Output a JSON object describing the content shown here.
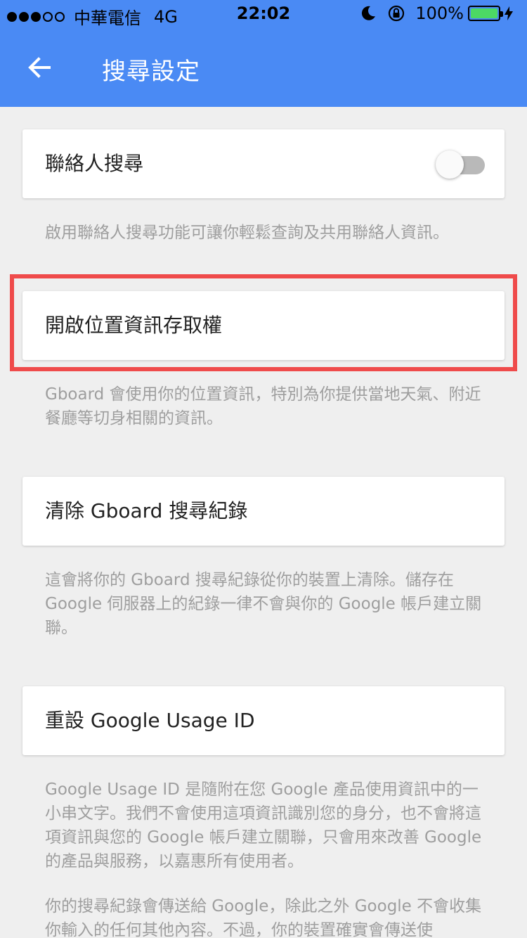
{
  "status_bar": {
    "carrier": "中華電信",
    "network": "4G",
    "time": "22:02",
    "battery": "100%"
  },
  "app_bar": {
    "title": "搜尋設定"
  },
  "settings": [
    {
      "label": "聯絡人搜尋",
      "toggle": false,
      "description": "啟用聯絡人搜尋功能可讓你輕鬆查詢及共用聯絡人資訊。"
    },
    {
      "label": "開啟位置資訊存取權",
      "description": "Gboard 會使用你的位置資訊，特別為你提供當地天氣、附近餐廳等切身相關的資訊。"
    },
    {
      "label": "清除 Gboard 搜尋紀錄",
      "description": "這會將你的 Gboard 搜尋紀錄從你的裝置上清除。儲存在 Google 伺服器上的紀錄一律不會與你的 Google 帳戶建立關聯。"
    },
    {
      "label": "重設 Google Usage ID",
      "description": "Google Usage ID 是隨附在您 Google 產品使用資訊中的一小串文字。我們不會使用這項資訊識別您的身分，也不會將這項資訊與您的 Google 帳戶建立關聯，只會用來改善 Google 的產品與服務，以嘉惠所有使用者。",
      "description2": "你的搜尋紀錄會傳送給 Google，除此之外 Google 不會收集你輸入的任何其他內容。不過，你的裝置確實會傳送使"
    }
  ],
  "colors": {
    "app_bar": "#4a8af4",
    "highlight": "#ef4b4b",
    "background": "#efefef"
  }
}
